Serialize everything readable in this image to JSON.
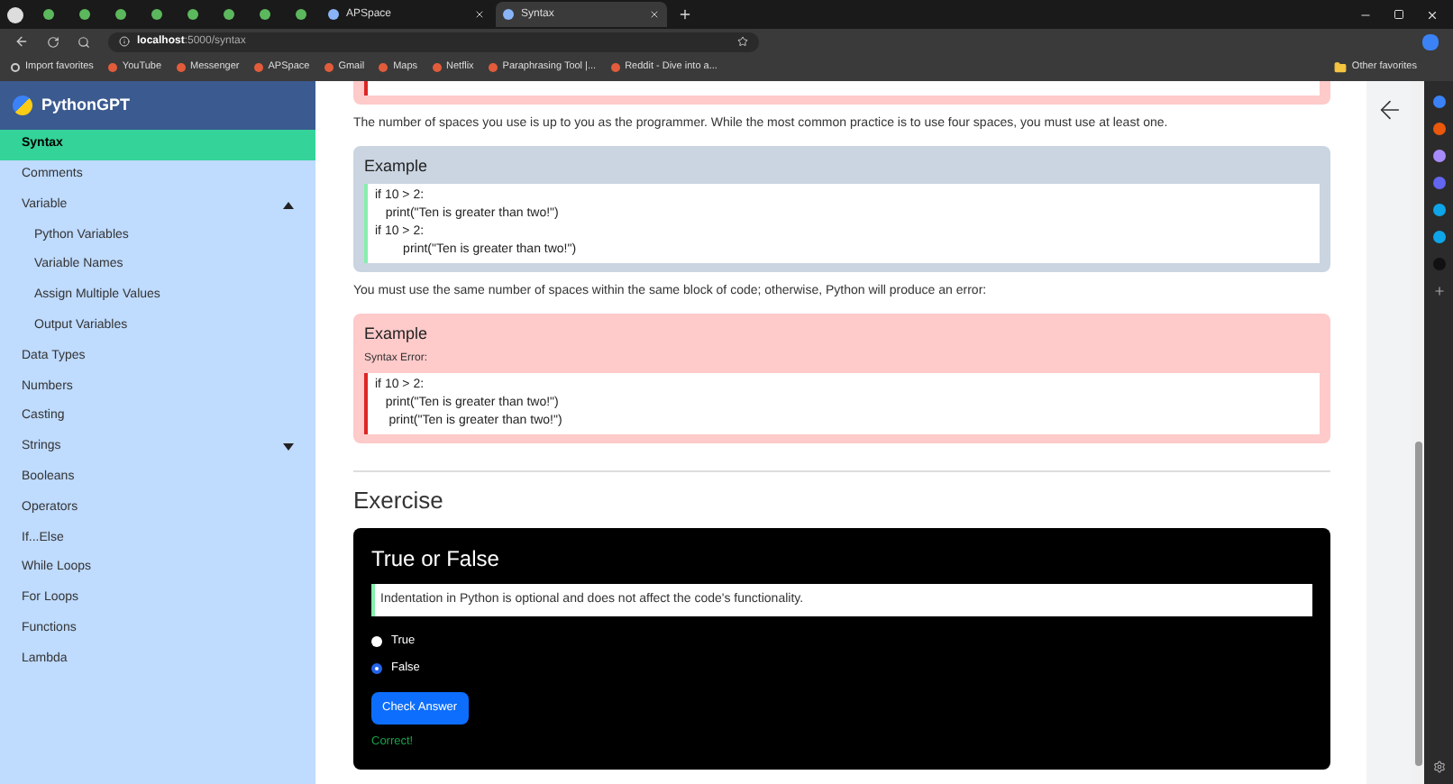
{
  "browser": {
    "tabs": [
      {
        "selected": false
      },
      {
        "selected": false
      },
      {
        "selected": false
      },
      {
        "selected": false
      },
      {
        "selected": false
      },
      {
        "selected": false
      },
      {
        "selected": false
      },
      {
        "selected": false
      },
      {
        "label": "APSpace",
        "selected": false
      },
      {
        "label": "Syntax",
        "selected": true
      }
    ],
    "address": {
      "host": "localhost",
      "path": ":5000/syntax"
    },
    "bookmarks": [
      "Import favorites",
      "YouTube",
      "Messenger",
      "APSpace",
      "Gmail",
      "Maps",
      "Netflix",
      "Paraphrasing Tool |...",
      "Reddit - Dive into a..."
    ],
    "other_favorites": "Other favorites"
  },
  "sidebar": {
    "title": "PythonGPT",
    "items": [
      {
        "label": "Syntax",
        "selected": true
      },
      {
        "label": "Comments",
        "selected": false
      },
      {
        "label": "Variable",
        "selected": false,
        "expanded": true,
        "children": [
          {
            "label": "Python Variables",
            "selected": false
          },
          {
            "label": "Variable Names",
            "selected": false
          },
          {
            "label": "Assign Multiple Values",
            "selected": false
          },
          {
            "label": "Output Variables",
            "selected": false
          }
        ]
      },
      {
        "label": "Data Types",
        "selected": false
      },
      {
        "label": "Numbers",
        "selected": false
      },
      {
        "label": "Casting",
        "selected": false
      },
      {
        "label": "Strings",
        "selected": false,
        "expanded": false
      },
      {
        "label": "Booleans",
        "selected": false
      },
      {
        "label": "Operators",
        "selected": false
      },
      {
        "label": "If...Else",
        "selected": false
      },
      {
        "label": "While Loops",
        "selected": false
      },
      {
        "label": "For Loops",
        "selected": false
      },
      {
        "label": "Functions",
        "selected": false
      },
      {
        "label": "Lambda",
        "selected": false
      }
    ]
  },
  "content": {
    "blocks": [
      {
        "kind": "error_example_tail"
      },
      {
        "kind": "paragraph",
        "text": "The number of spaces you use is up to you as the programmer. While the most common practice is to use four spaces, you must use at least one."
      },
      {
        "kind": "example",
        "title": "Example",
        "code": [
          "if 10 > 2:",
          "   print(\"Ten is greater than two!\")",
          "if 10 > 2:",
          "        print(\"Ten is greater than two!\")"
        ]
      },
      {
        "kind": "paragraph",
        "text": "You must use the same number of spaces within the same block of code; otherwise, Python will produce an error:"
      },
      {
        "kind": "error_example",
        "title": "Example",
        "note": "Syntax Error:",
        "code": [
          "if 10 > 2:",
          "   print(\"Ten is greater than two!\")",
          "    print(\"Ten is greater than two!\")"
        ]
      }
    ]
  },
  "exercise": {
    "heading": "Exercise",
    "title": "True or False",
    "statement": "Indentation in Python is optional and does not affect the code's functionality.",
    "options": [
      {
        "label": "True",
        "selected": false
      },
      {
        "label": "False",
        "selected": true
      }
    ],
    "button": "Check Answer",
    "result": "Correct!"
  }
}
